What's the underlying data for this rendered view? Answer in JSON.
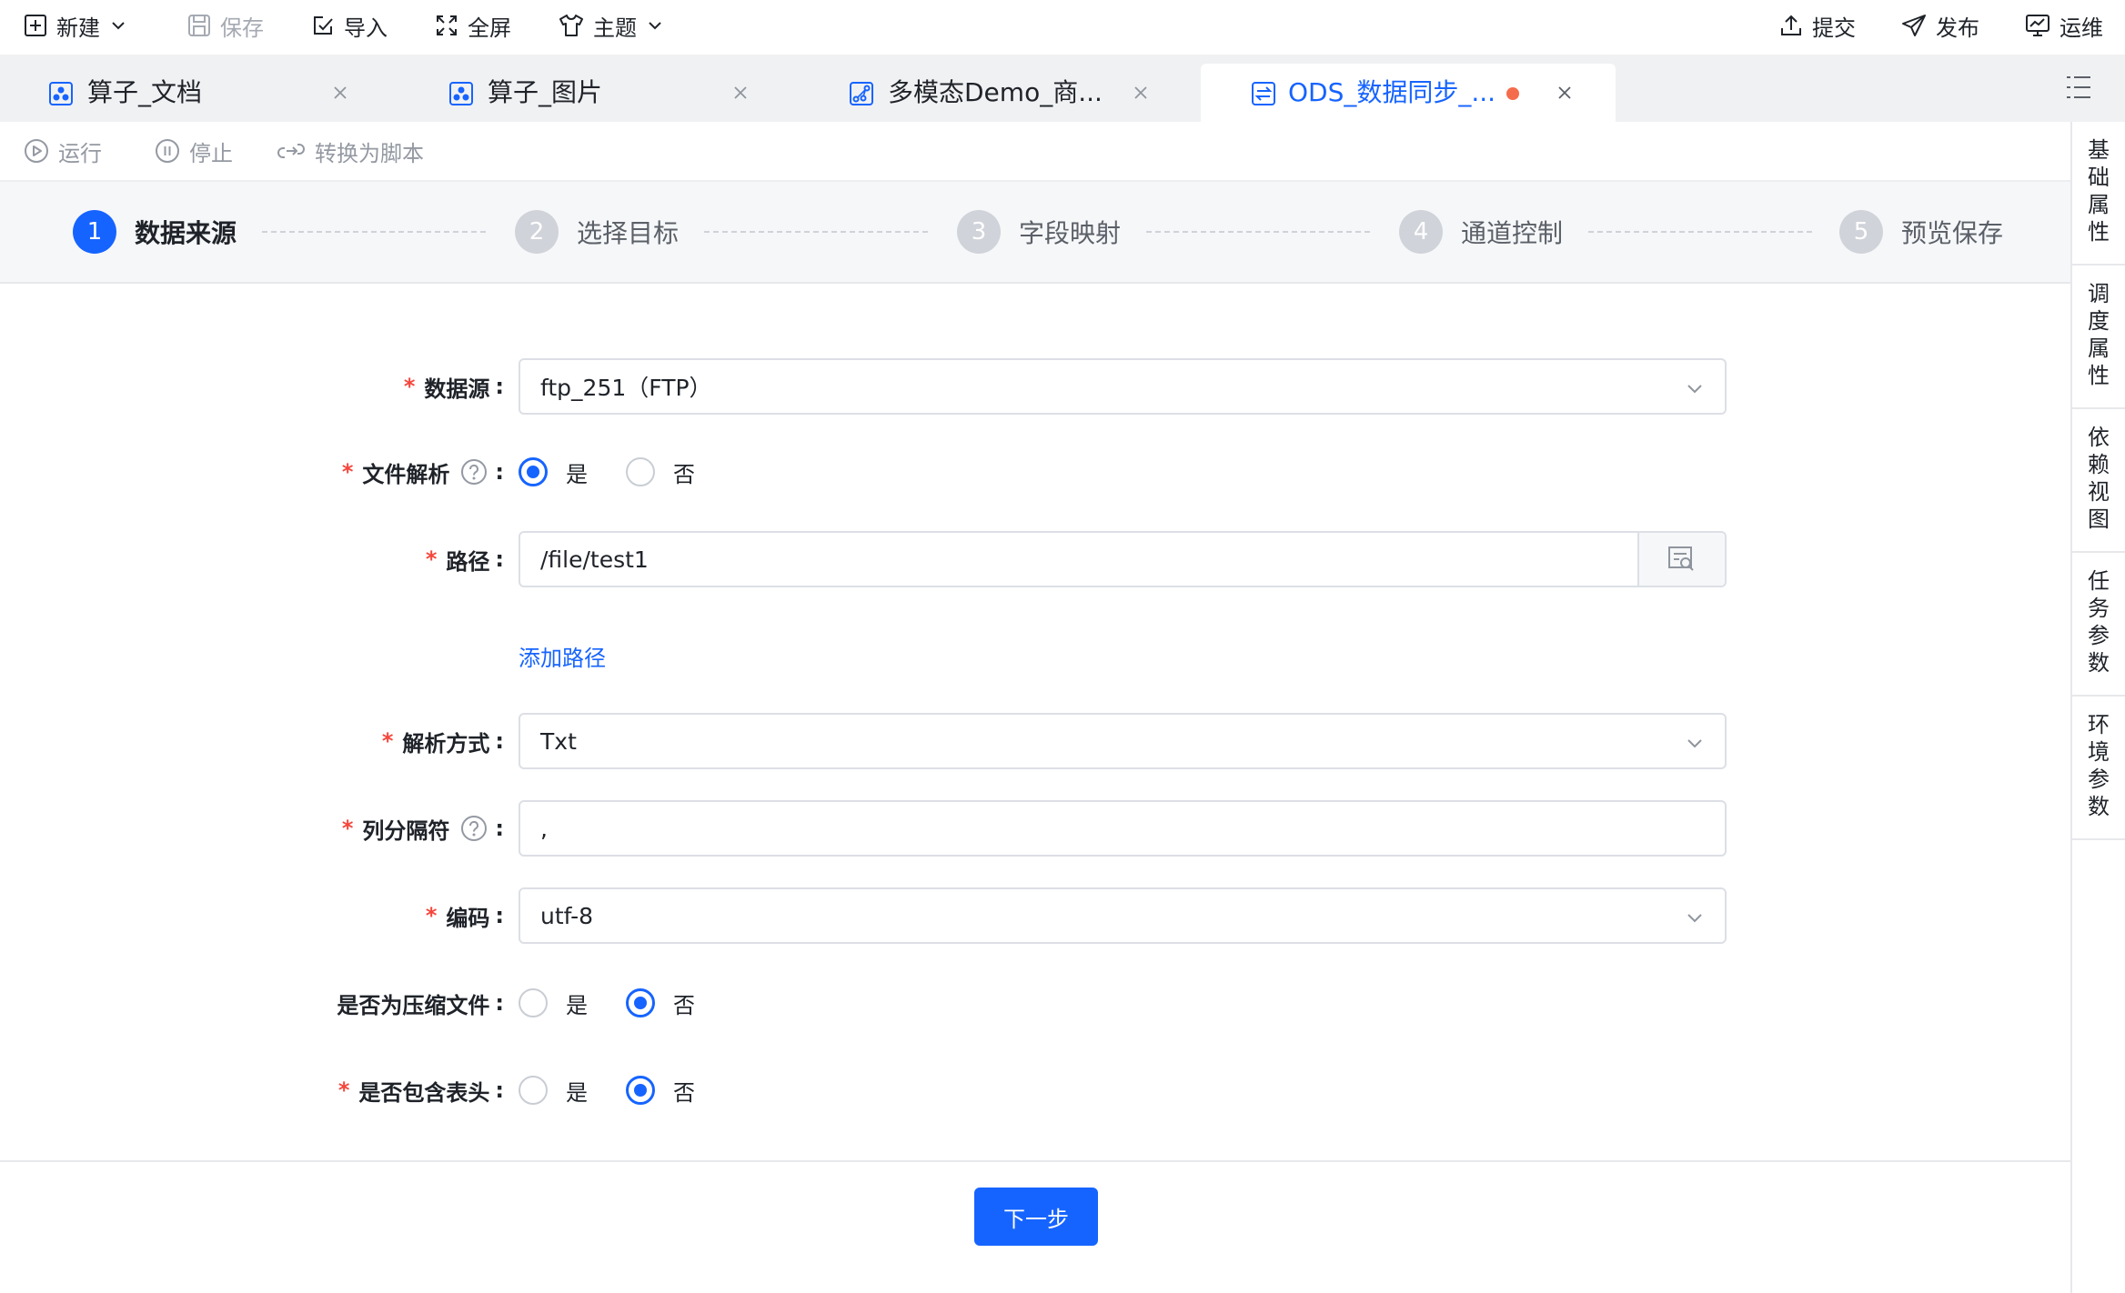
{
  "toolbar": {
    "new_label": "新建",
    "save_label": "保存",
    "import_label": "导入",
    "fullscreen_label": "全屏",
    "theme_label": "主题",
    "submit_label": "提交",
    "publish_label": "发布",
    "ops_label": "运维"
  },
  "tabs": [
    {
      "label": "算子_文档",
      "icon": "operator-icon",
      "active": false
    },
    {
      "label": "算子_图片",
      "icon": "operator-icon",
      "active": false
    },
    {
      "label": "多模态Demo_商...",
      "icon": "flow-icon",
      "active": false
    },
    {
      "label": "ODS_数据同步_...",
      "icon": "sync-icon",
      "active": true,
      "unsaved": true
    }
  ],
  "actions": {
    "run_label": "运行",
    "stop_label": "停止",
    "convert_label": "转换为脚本"
  },
  "steps": [
    {
      "num": "1",
      "title": "数据来源",
      "active": true
    },
    {
      "num": "2",
      "title": "选择目标",
      "active": false
    },
    {
      "num": "3",
      "title": "字段映射",
      "active": false
    },
    {
      "num": "4",
      "title": "通道控制",
      "active": false
    },
    {
      "num": "5",
      "title": "预览保存",
      "active": false
    }
  ],
  "form": {
    "datasource": {
      "label": "数据源",
      "required": true,
      "value": "ftp_251（FTP）"
    },
    "file_parse": {
      "label": "文件解析",
      "required": true,
      "yes": "是",
      "no": "否",
      "selected": "是"
    },
    "path": {
      "label": "路径",
      "required": true,
      "value": "/file/test1"
    },
    "add_path_label": "添加路径",
    "parse_mode": {
      "label": "解析方式",
      "required": true,
      "value": "Txt"
    },
    "column_sep": {
      "label": "列分隔符",
      "required": true,
      "value": ","
    },
    "encoding": {
      "label": "编码",
      "required": true,
      "value": "utf-8"
    },
    "compressed": {
      "label": "是否为压缩文件",
      "required": false,
      "yes": "是",
      "no": "否",
      "selected": "否"
    },
    "has_header": {
      "label": "是否包含表头",
      "required": true,
      "yes": "是",
      "no": "否",
      "selected": "否"
    }
  },
  "right_rail": [
    {
      "label": "基础属性"
    },
    {
      "label": "调度属性"
    },
    {
      "label": "依赖视图"
    },
    {
      "label": "任务参数"
    },
    {
      "label": "环境参数"
    }
  ],
  "footer": {
    "next_label": "下一步"
  },
  "colors": {
    "primary": "#1664ff",
    "required": "#f5463c",
    "unsaved_dot": "#f56c4d"
  }
}
